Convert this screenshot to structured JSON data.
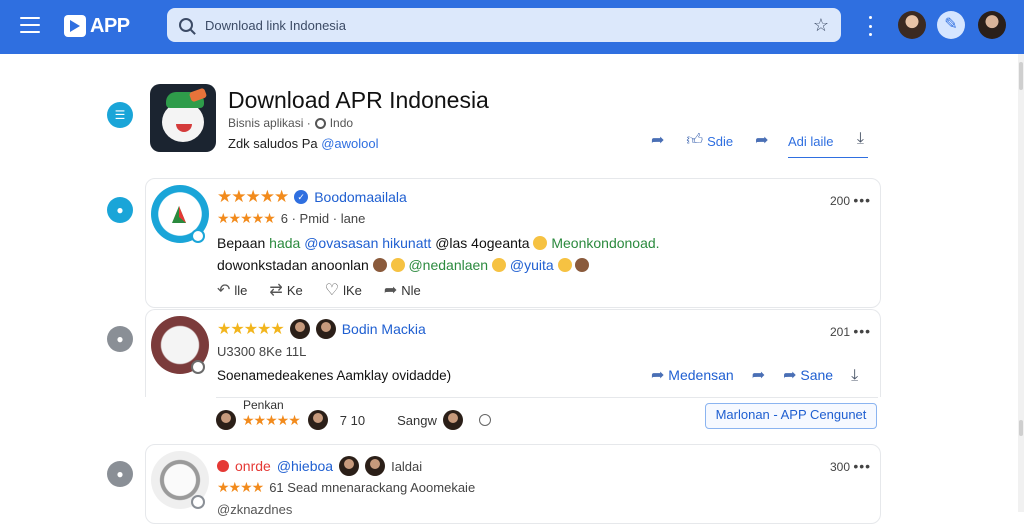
{
  "topbar": {
    "logo_text": "APP",
    "search": {
      "value": "Download link Indonesia",
      "placeholder": "Download link Indonesia"
    }
  },
  "app": {
    "title": "Download APR Indonesia",
    "meta": "Bisnis aplikasi ·",
    "meta_link": "Indo",
    "developer": "Zdk saludos Pa",
    "developer_handle": "@awolool",
    "actions": {
      "share": "",
      "like": "Sdie",
      "forward": ""
    },
    "add_button": "Adi laile"
  },
  "comments": [
    {
      "name": "Boodomaailala",
      "sub": "6 · Pmid · lane",
      "time": "200",
      "text_a": "Bepaan",
      "text_b": "hada",
      "text_c": "@ovasasan hikunatt",
      "text_d": "@las 4ogeanta",
      "text_e": "Meonkondonoad.",
      "line2_a": "dowonkstadan anoonlan",
      "line2_b": "@nedanlaen",
      "line2_c": "@yuita",
      "actions": {
        "reply": "lle",
        "repost": "Ke",
        "like": "lKe",
        "share": "Nle"
      }
    },
    {
      "name": "Bodin Mackia",
      "sub": "U3300 8Ke 11L",
      "time": "201",
      "text": "Soenamedeakenes Aamklay ovidadde)",
      "actions": {
        "mention": "Medensan",
        "share": "Sane"
      },
      "reactions": {
        "label": "Penkan",
        "count": "7 10",
        "user": "Sangw",
        "button": "Marlonan - APP Cengunet"
      }
    },
    {
      "name_a": "onrde",
      "name_b": "@hieboa",
      "name_c": "Ialdai",
      "sub": "61 Sead mnenarackang Aoomekaie",
      "time": "300",
      "text": "@zknazdnes"
    }
  ],
  "colors": {
    "accent": "#2f6fe0",
    "star": "#f28b1d",
    "rail": "#1aa5d8"
  }
}
